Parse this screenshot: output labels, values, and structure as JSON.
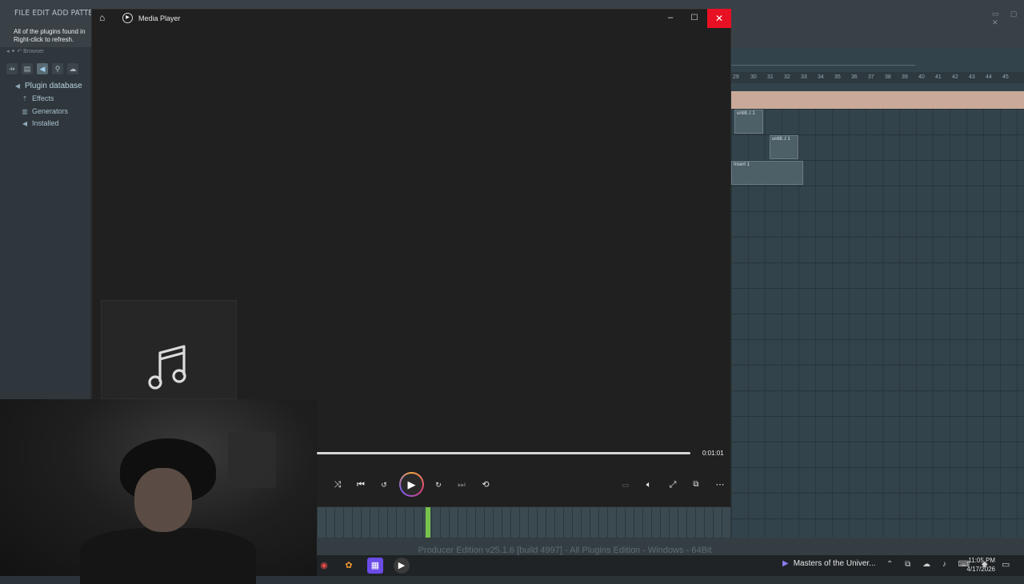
{
  "fl": {
    "menu": "FILE  EDIT  ADD  PATTERNS  V",
    "hint_line1": "All of the plugins found in",
    "hint_line2": "Right-click to refresh.",
    "browser_title": "Browser",
    "tree": {
      "root": "Plugin database",
      "items": [
        "Effects",
        "Generators",
        "Installed"
      ]
    },
    "ruler_ticks": [
      "29",
      "30",
      "31",
      "32",
      "33",
      "34",
      "35",
      "36",
      "37",
      "38",
      "39",
      "40",
      "41",
      "42",
      "43",
      "44",
      "45"
    ],
    "clips": [
      "untitl..t 1",
      "untitl..t 1",
      "Insert 1"
    ],
    "status_text": "Producer Edition v25.1.6 [build 4997] - All Plugins Edition - Windows - 64Bit"
  },
  "media_player": {
    "title": "Media Player",
    "time": "0:01:01",
    "accent_gradient": [
      "#f5a442",
      "#d6407a",
      "#7a5cf0"
    ],
    "close_color": "#e81123"
  },
  "taskbar": {
    "now_playing": "Masters of the Univer...",
    "clock_time": "11:05 PM",
    "clock_date": "4/17/2026"
  }
}
